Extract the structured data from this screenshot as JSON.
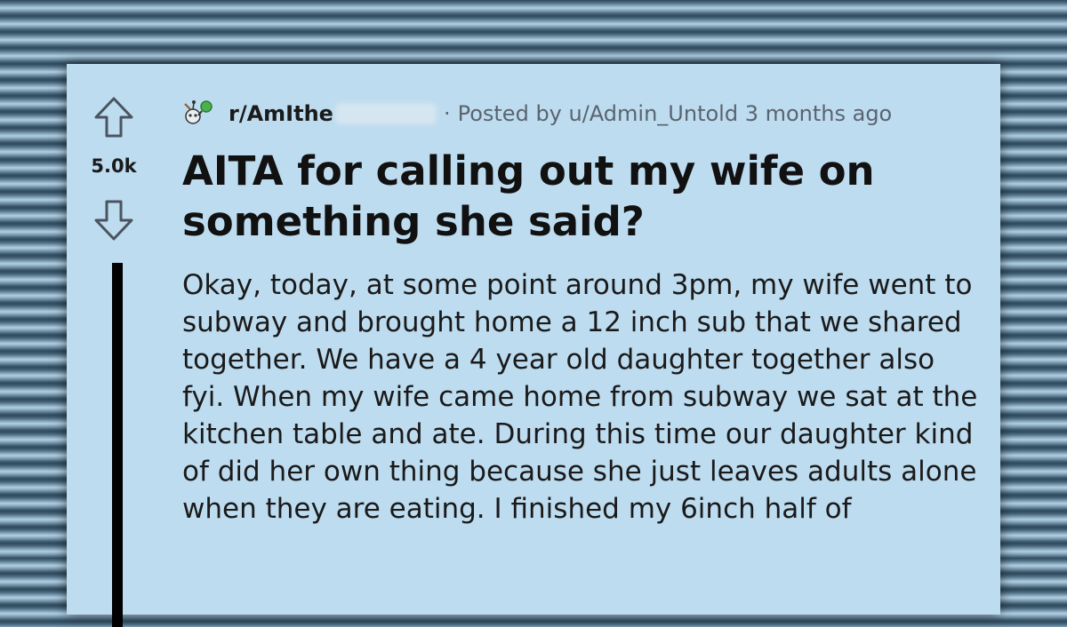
{
  "post": {
    "subreddit": "r/AmIthe",
    "separator": "·",
    "posted_by": "Posted by u/Admin_Untold 3 months ago",
    "score": "5.0k",
    "title": "AITA for calling out my wife on something she said?",
    "body": "Okay, today, at some point around 3pm, my wife went to subway and brought home a 12 inch sub that we shared together. We have a 4 year old daughter together also fyi. When my wife came home from subway we sat at the kitchen table and ate. During this time our daughter kind of did her own thing because she just leaves adults alone when they are eating. I finished my 6inch half of"
  },
  "icons": {
    "upvote": "upvote-arrow-icon",
    "downvote": "downvote-arrow-icon",
    "subreddit": "subreddit-snoo-icon"
  },
  "colors": {
    "card_background": "#bedcef",
    "thread_line": "#000000",
    "meta_text": "#5a6470"
  }
}
